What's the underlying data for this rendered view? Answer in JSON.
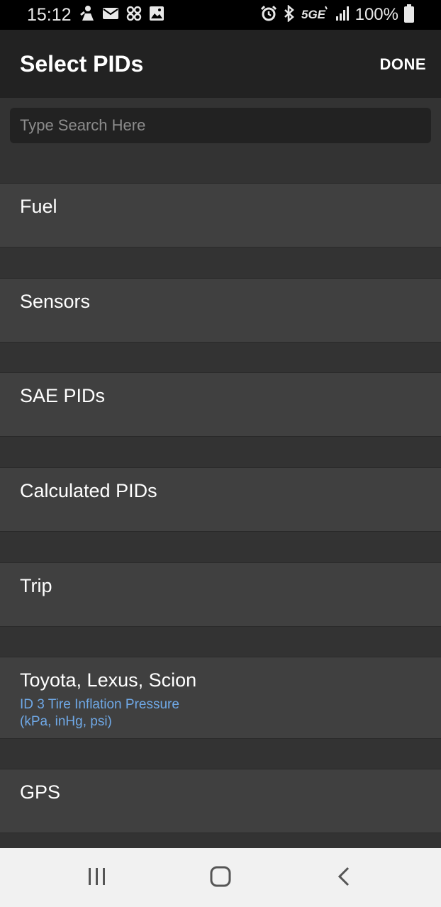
{
  "status_bar": {
    "time": "15:12",
    "battery": "100%",
    "left_icons": [
      "notification-figure-icon",
      "mail-icon",
      "pinwheel-icon",
      "image-icon"
    ],
    "right_icons": [
      "alarm-icon",
      "bluetooth-icon",
      "5ge-network-icon",
      "signal-icon",
      "battery-icon"
    ],
    "network_label": "5GE"
  },
  "app_bar": {
    "title": "Select PIDs",
    "done_label": "DONE"
  },
  "search": {
    "placeholder": "Type Search Here",
    "value": ""
  },
  "categories": [
    {
      "label": "Fuel",
      "sub1": "",
      "sub2": ""
    },
    {
      "label": "Sensors",
      "sub1": "",
      "sub2": ""
    },
    {
      "label": "SAE PIDs",
      "sub1": "",
      "sub2": ""
    },
    {
      "label": "Calculated PIDs",
      "sub1": "",
      "sub2": ""
    },
    {
      "label": "Trip",
      "sub1": "",
      "sub2": ""
    },
    {
      "label": "Toyota, Lexus, Scion",
      "sub1": "ID 3 Tire Inflation Pressure",
      "sub2": "(kPa, inHg, psi)"
    },
    {
      "label": "GPS",
      "sub1": "",
      "sub2": ""
    }
  ],
  "nav_bar": {
    "recents_icon": "recent-apps-icon",
    "home_icon": "home-icon",
    "back_icon": "back-icon"
  },
  "colors": {
    "background": "#333333",
    "app_bar": "#222222",
    "list_item": "#404040",
    "accent_subtext": "#6fa8e6",
    "nav_bar": "#f1f1f1"
  }
}
